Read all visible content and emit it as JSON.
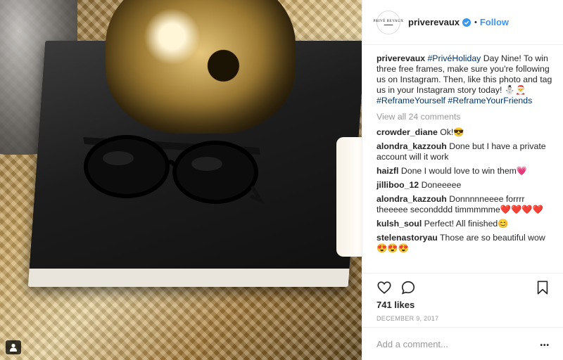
{
  "post": {
    "username": "priverevaux",
    "follow_label": "Follow",
    "dot": "•",
    "avatar_text": "PRIVÉ REVAUX",
    "caption": {
      "user": "priverevaux",
      "tag1": "#PrivéHoliday",
      "text1": " Day Nine! To win three free frames, make sure you're following us on Instagram. Then, like this photo and tag us in your Instagram story today! ⛄🎅 ",
      "tag2": "#ReframeYourself",
      "tag3": "#ReframeYourFriends"
    },
    "view_all": "View all 24 comments",
    "comments": [
      {
        "user": "crowder_diane",
        "text": "Ok!😎"
      },
      {
        "user": "alondra_kazzouh",
        "text": "Done but I have a private account will it work"
      },
      {
        "user": "haizfl",
        "text": "Done I would love to win them💗"
      },
      {
        "user": "jilliboo_12",
        "text": "Doneeeee"
      },
      {
        "user": "alondra_kazzouh",
        "text": "Donnnnneeee forrrr theeeee secondddd timmmmme❤️❤️❤️❤️"
      },
      {
        "user": "kulsh_soul",
        "text": "Perfect! All finished😊"
      },
      {
        "user": "stelenastoryau",
        "text": "Those are so beautiful wow😍😍😍"
      }
    ],
    "likes": "741 likes",
    "date": "DECEMBER 9, 2017",
    "add_comment_placeholder": "Add a comment...",
    "more_label": "•••"
  },
  "icons": {
    "verified": "verified-badge-icon",
    "like": "heart-icon",
    "comment": "speech-bubble-icon",
    "save": "bookmark-icon",
    "tag": "user-tag-icon",
    "more": "more-options-icon"
  },
  "colors": {
    "link": "#3897f0",
    "hashtag": "#003569",
    "muted": "#999999",
    "text": "#262626"
  }
}
